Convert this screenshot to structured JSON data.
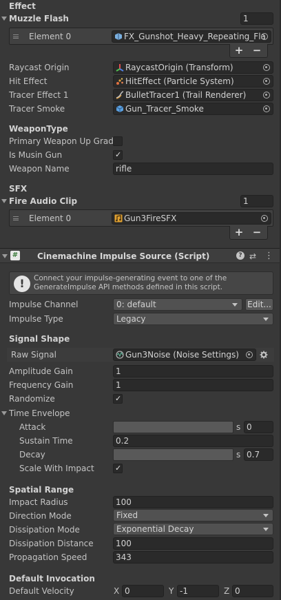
{
  "effect_section": {
    "title": "Effect",
    "muzzle_flash": {
      "label": "Muzzle Flash",
      "count": "1",
      "element_label": "Element 0",
      "element_value": "FX_Gunshot_Heavy_Repeating_Fla"
    },
    "plus": "+",
    "minus": "−",
    "raycast_origin": {
      "label": "Raycast Origin",
      "value": "RaycastOrigin (Transform)"
    },
    "hit_effect": {
      "label": "Hit Effect",
      "value": "HitEffect (Particle System)"
    },
    "tracer_effect": {
      "label": "Tracer Effect 1",
      "value": "BulletTracer1 (Trail Renderer)"
    },
    "tracer_smoke": {
      "label": "Tracer Smoke",
      "value": "Gun_Tracer_Smoke"
    }
  },
  "weapon_type": {
    "title": "WeaponType",
    "primary_upgrade": {
      "label": "Primary Weapon Up Grade",
      "checked": false
    },
    "is_musin_gun": {
      "label": "Is Musin Gun",
      "checked": true
    },
    "weapon_name": {
      "label": "Weapon Name",
      "value": "rifle"
    }
  },
  "sfx": {
    "title": "SFX",
    "fire_audio_clip": {
      "label": "Fire Audio Clip",
      "count": "1",
      "element_label": "Element 0",
      "element_value": "Gun3FireSFX"
    }
  },
  "component": {
    "icon_text": "#",
    "title": "Cinemachine Impulse Source (Script)",
    "help_glyph": "?",
    "settings_glyph": "⇄",
    "menu_glyph": "⋮",
    "info_icon": "!",
    "info_message": "Connect your impulse-generating event to one of the GenerateImpulse API methods defined in this script.",
    "impulse_channel": {
      "label": "Impulse Channel",
      "value": "0: default",
      "edit_label": "Edit..."
    },
    "impulse_type": {
      "label": "Impulse Type",
      "value": "Legacy"
    }
  },
  "signal_shape": {
    "title": "Signal Shape",
    "raw_signal": {
      "label": "Raw Signal",
      "value": "Gun3Noise (Noise Settings)"
    },
    "amplitude_gain": {
      "label": "Amplitude Gain",
      "value": "1"
    },
    "frequency_gain": {
      "label": "Frequency Gain",
      "value": "1"
    },
    "randomize": {
      "label": "Randomize",
      "checked": true
    },
    "time_envelope": {
      "label": "Time Envelope",
      "attack": {
        "label": "Attack",
        "unit": "s",
        "value": "0"
      },
      "sustain_time": {
        "label": "Sustain Time",
        "value": "0.2"
      },
      "decay": {
        "label": "Decay",
        "unit": "s",
        "value": "0.7"
      },
      "scale_with_impact": {
        "label": "Scale With Impact",
        "checked": true
      }
    }
  },
  "spatial_range": {
    "title": "Spatial Range",
    "impact_radius": {
      "label": "Impact Radius",
      "value": "100"
    },
    "direction_mode": {
      "label": "Direction Mode",
      "value": "Fixed"
    },
    "dissipation_mode": {
      "label": "Dissipation Mode",
      "value": "Exponential Decay"
    },
    "dissipation_distance": {
      "label": "Dissipation Distance",
      "value": "100"
    },
    "propagation_speed": {
      "label": "Propagation Speed",
      "value": "343"
    }
  },
  "default_invocation": {
    "title": "Default Invocation",
    "default_velocity": {
      "label": "Default Velocity",
      "x_label": "X",
      "x": "0",
      "y_label": "Y",
      "y": "-1",
      "z_label": "Z",
      "z": "0"
    }
  },
  "check_glyph": "✓",
  "colors": {
    "background": "#383838",
    "field": "#2a2a2a",
    "dropdown": "#515151",
    "audio_icon": "#e0a030",
    "mesh_icon": "#5aa0e0",
    "info_bg": "#464646"
  }
}
